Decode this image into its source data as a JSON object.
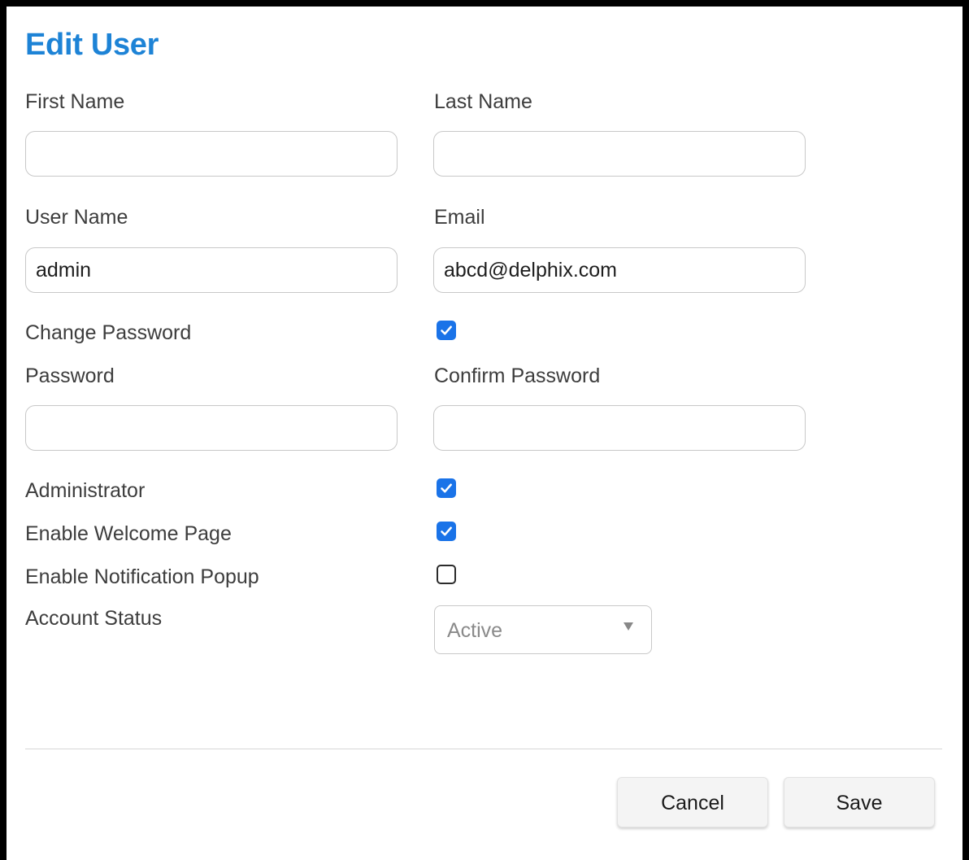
{
  "dialog": {
    "title": "Edit User"
  },
  "fields": {
    "first_name": {
      "label": "First Name",
      "value": "",
      "placeholder": ""
    },
    "last_name": {
      "label": "Last Name",
      "value": "",
      "placeholder": ""
    },
    "user_name": {
      "label": "User Name",
      "value": "admin",
      "placeholder": ""
    },
    "email": {
      "label": "Email",
      "value": "abcd@delphix.com",
      "placeholder": ""
    },
    "password": {
      "label": "Password",
      "value": "",
      "placeholder": ""
    },
    "confirm_password": {
      "label": "Confirm Password",
      "value": "",
      "placeholder": ""
    }
  },
  "options": {
    "change_password": {
      "label": "Change Password",
      "checked": true
    },
    "administrator": {
      "label": "Administrator",
      "checked": true
    },
    "enable_welcome_page": {
      "label": "Enable Welcome Page",
      "checked": true
    },
    "enable_notification_popup": {
      "label": "Enable Notification Popup",
      "checked": false
    }
  },
  "account_status": {
    "label": "Account Status",
    "selected": "Active"
  },
  "buttons": {
    "cancel": "Cancel",
    "save": "Save"
  },
  "colors": {
    "title": "#1d83d6",
    "checkbox_checked": "#1a73e8"
  }
}
